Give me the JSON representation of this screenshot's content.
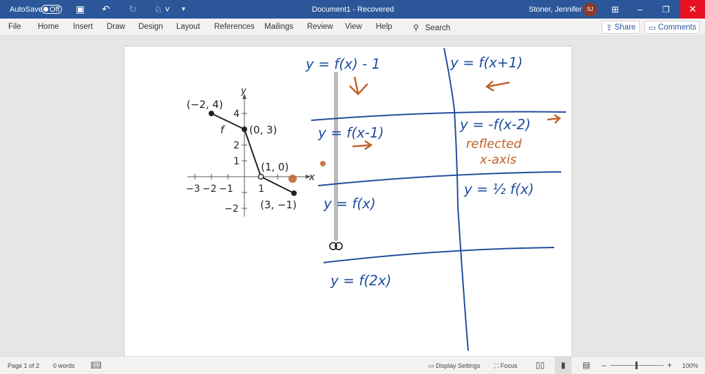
{
  "titlebar": {
    "autosave_label": "AutoSave",
    "autosave_state": "Off",
    "document_title": "Document1  -  Recovered",
    "user_name": "Stoner, Jennifer L",
    "user_initials": "SJ"
  },
  "ribbon": {
    "tabs": [
      "File",
      "Home",
      "Insert",
      "Draw",
      "Design",
      "Layout",
      "References",
      "Mailings",
      "Review",
      "View",
      "Help"
    ],
    "search_label": "Search",
    "share_label": "Share",
    "comments_label": "Comments"
  },
  "figure": {
    "function_label": "f",
    "x_axis_label": "x",
    "y_axis_label": "y",
    "x_ticks": [
      "−3",
      "−2",
      "−1",
      "1"
    ],
    "y_ticks": [
      "4",
      "2",
      "1",
      "−2"
    ],
    "points": [
      {
        "label": "(−2, 4)",
        "x": -2,
        "y": 4
      },
      {
        "label": "(0, 3)",
        "x": 0,
        "y": 3
      },
      {
        "label": "(1, 0)",
        "x": 1,
        "y": 0
      },
      {
        "label": "(3, −1)",
        "x": 3,
        "y": -1
      }
    ]
  },
  "handwriting": {
    "cell1": "y = f(x) - 1",
    "cell2": "y = f(x+1)",
    "cell3": "y = f(x-1)",
    "cell4": "y = -f(x-2)",
    "cell4_note1": "reflected",
    "cell4_note2": "x-axis",
    "cell5": "y = f(x)",
    "cell6": "y = ½ f(x)",
    "cell7": "y = f(2x)",
    "ink_blue": "#1f4e9c",
    "ink_orange": "#c0622a"
  },
  "status": {
    "page": "Page 1 of 2",
    "words": "0 words",
    "display_settings": "Display Settings",
    "focus": "Focus",
    "zoom": "100%",
    "zoom_level_percent": 100
  }
}
